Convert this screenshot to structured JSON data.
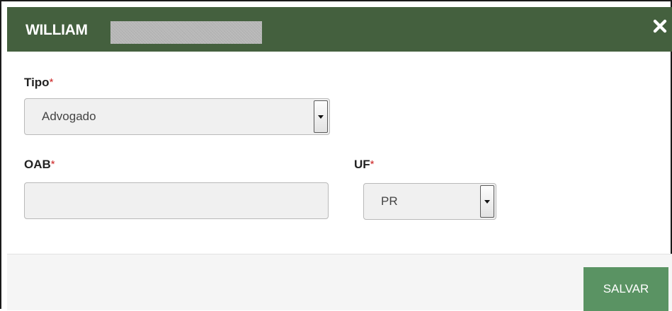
{
  "modal": {
    "title": "WILLIAM",
    "close_icon": "close-icon",
    "header_color": "#44603e"
  },
  "form": {
    "tipo": {
      "label": "Tipo",
      "required_mark": "*",
      "value": "Advogado"
    },
    "oab": {
      "label": "OAB",
      "required_mark": "*",
      "value": "",
      "placeholder": ""
    },
    "uf": {
      "label": "UF",
      "required_mark": "*",
      "value": "PR"
    }
  },
  "footer": {
    "save_label": "SALVAR",
    "save_color": "#5a9363"
  }
}
